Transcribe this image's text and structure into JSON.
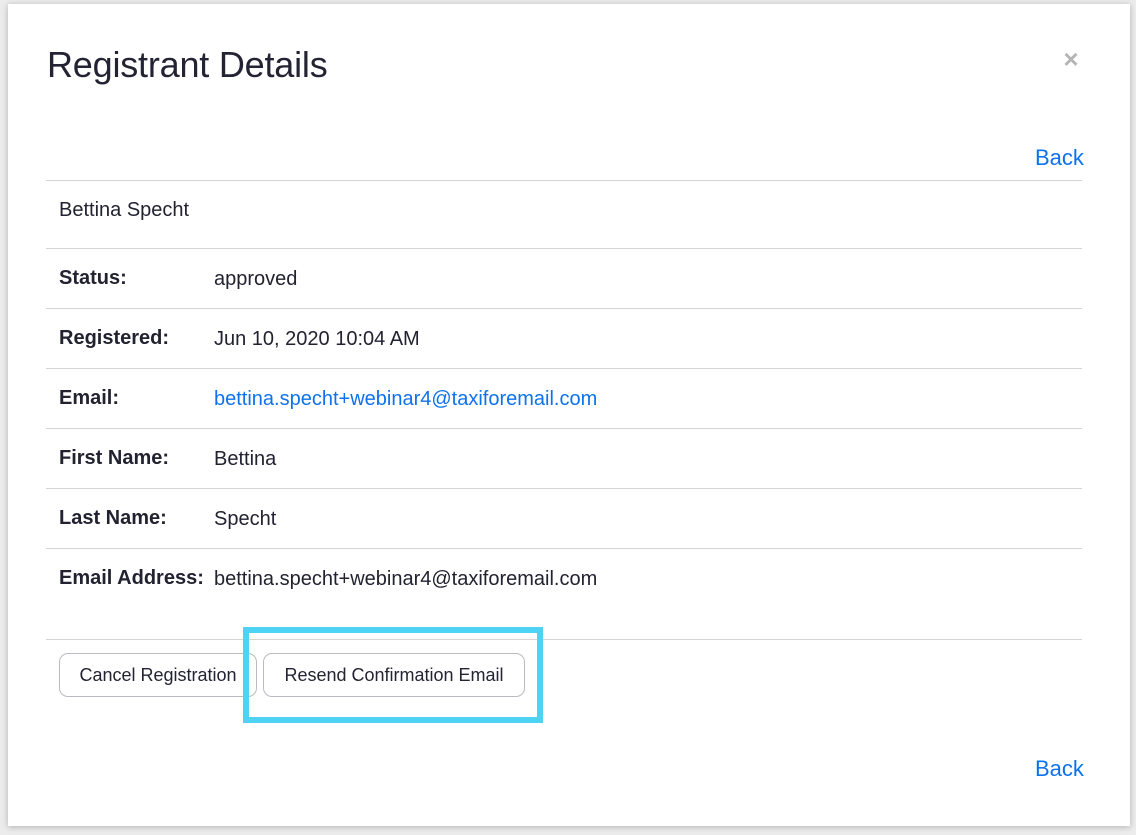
{
  "modal": {
    "title": "Registrant Details",
    "close_symbol": "×",
    "back_label": "Back"
  },
  "registrant": {
    "full_name": "Bettina Specht",
    "fields": [
      {
        "label": "Status:",
        "value": "approved"
      },
      {
        "label": "Registered:",
        "value": "Jun 10, 2020 10:04 AM"
      },
      {
        "label": "Email:",
        "value": "bettina.specht+webinar4@taxiforemail.com"
      },
      {
        "label": "First Name:",
        "value": "Bettina"
      },
      {
        "label": "Last Name:",
        "value": "Specht"
      },
      {
        "label": "Email Address:",
        "value": "bettina.specht+webinar4@taxiforemail.com"
      }
    ]
  },
  "actions": {
    "cancel_label": "Cancel Registration",
    "resend_label": "Resend Confirmation Email"
  },
  "colors": {
    "link": "#0e72ed",
    "highlight": "#4dd4f4",
    "text": "#232333",
    "divider": "#d5d5d5"
  },
  "icons": {
    "close": "close-icon"
  }
}
